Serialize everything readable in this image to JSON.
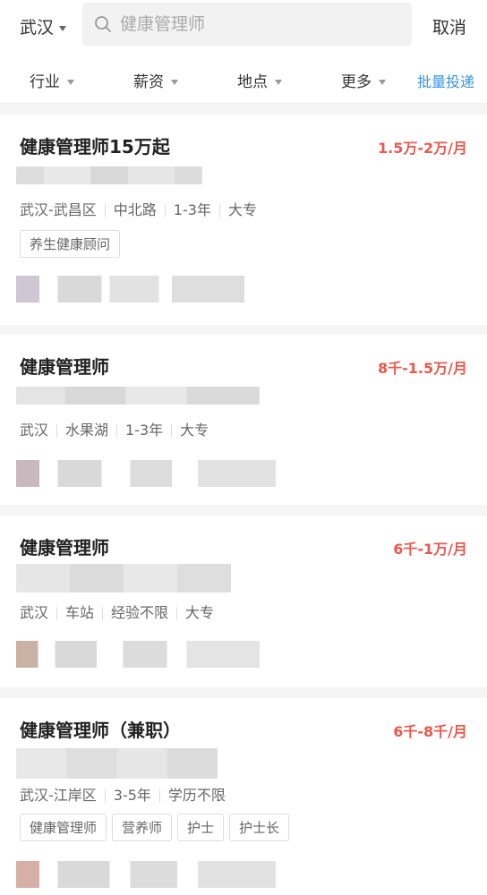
{
  "header": {
    "city": "武汉",
    "search_placeholder": "健康管理师",
    "cancel_label": "取消"
  },
  "filters": {
    "industry": "行业",
    "salary": "薪资",
    "location": "地点",
    "more": "更多",
    "batch_apply": "批量投递"
  },
  "jobs": [
    {
      "title": "健康管理师15万起",
      "salary": "1.5万-2万/月",
      "meta": [
        "武汉-武昌区",
        "中北路",
        "1-3年",
        "大专"
      ],
      "tags": [
        "养生健康顾问"
      ]
    },
    {
      "title": "健康管理师",
      "salary": "8千-1.5万/月",
      "meta": [
        "武汉",
        "水果湖",
        "1-3年",
        "大专"
      ],
      "tags": []
    },
    {
      "title": "健康管理师",
      "salary": "6千-1万/月",
      "meta": [
        "武汉",
        "车站",
        "经验不限",
        "大专"
      ],
      "tags": []
    },
    {
      "title": "健康管理师（兼职）",
      "salary": "6千-8千/月",
      "meta": [
        "武汉-江岸区",
        "3-5年",
        "学历不限"
      ],
      "tags": [
        "健康管理师",
        "营养师",
        "护士",
        "护士长"
      ]
    }
  ]
}
